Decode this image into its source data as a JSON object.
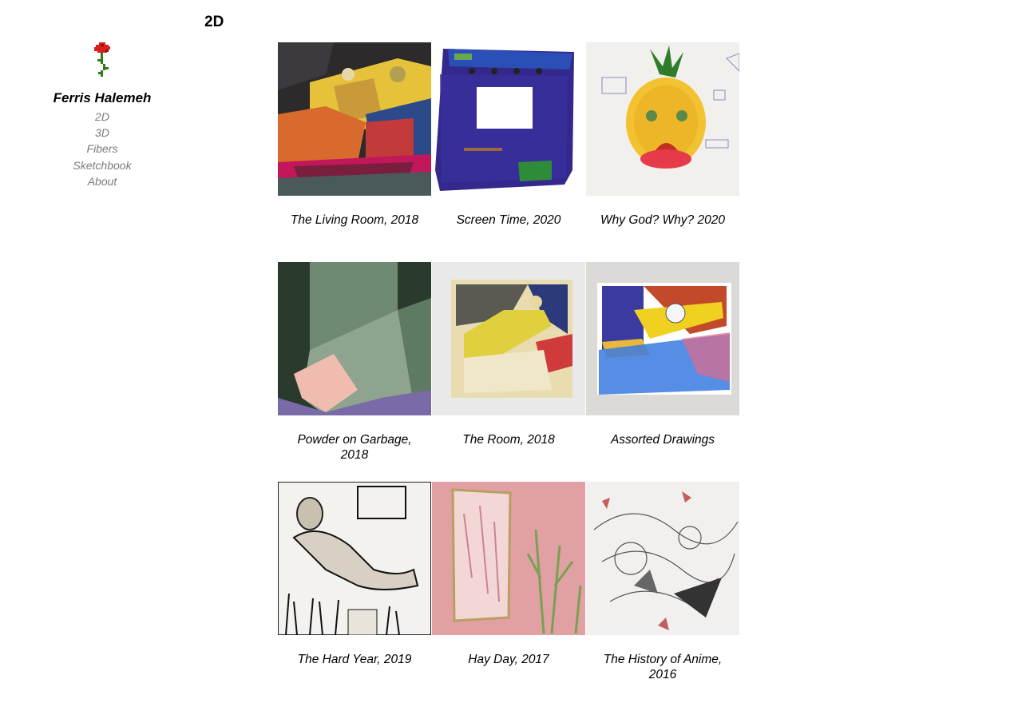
{
  "site": {
    "title": "Ferris Halemeh",
    "logo_icon": "pixel-rose-icon"
  },
  "nav": {
    "items": [
      {
        "label": "2D"
      },
      {
        "label": "3D"
      },
      {
        "label": "Fibers"
      },
      {
        "label": "Sketchbook"
      },
      {
        "label": "About"
      }
    ]
  },
  "page": {
    "heading": "2D"
  },
  "gallery": {
    "items": [
      {
        "caption": "The Living Room, 2018"
      },
      {
        "caption": "Screen Time, 2020"
      },
      {
        "caption": "Why God? Why? 2020"
      },
      {
        "caption": "Powder on Garbage, 2018"
      },
      {
        "caption": "The Room, 2018"
      },
      {
        "caption": "Assorted Drawings"
      },
      {
        "caption": "The Hard Year, 2019"
      },
      {
        "caption": "Hay Day, 2017"
      },
      {
        "caption": "The History of Anime, 2016"
      }
    ]
  },
  "colors": {
    "nav_text": "#7a7a7a",
    "title_text": "#000000",
    "rose_red": "#d81f1f",
    "rose_stem": "#2e7d1a"
  }
}
